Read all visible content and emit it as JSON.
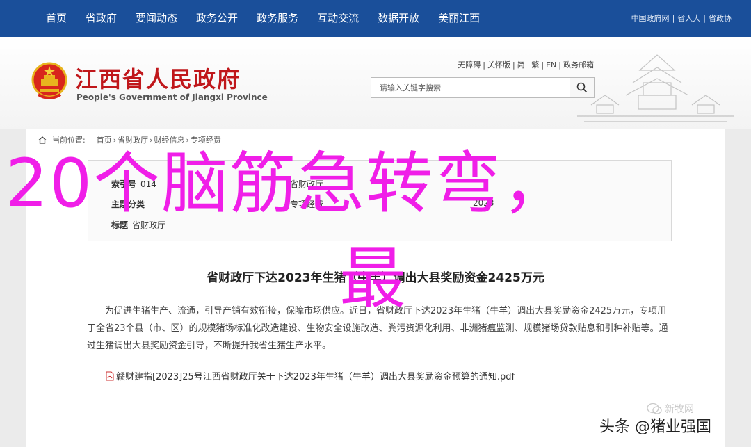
{
  "nav": {
    "items": [
      "首页",
      "省政府",
      "要闻动态",
      "政务公开",
      "政务服务",
      "互动交流",
      "数据开放",
      "美丽江西"
    ],
    "links": [
      "中国政府网",
      "省人大",
      "省政协"
    ]
  },
  "header": {
    "title": "江西省人民政府",
    "subtitle": "People's Government of Jiangxi Province",
    "access": [
      "无障碍",
      "关怀版",
      "简",
      "繁",
      "EN",
      "政务邮箱"
    ],
    "search_placeholder": "请输入关键字搜索"
  },
  "breadcrumb": {
    "label": "当前位置:",
    "items": [
      "首页",
      "省财政厅",
      "财经信息",
      "专项经费"
    ]
  },
  "meta": {
    "row1_key": "索引号",
    "row1_value": "014",
    "row1_col3": "省财政厅",
    "row2_key": "主题分类",
    "row2_col2": "专项经费",
    "row2_col3": "2023",
    "row3_key": "标题",
    "row3_value": "省财政厅"
  },
  "article": {
    "title": "省财政厅下达2023年生猪（牛羊）调出大县奖励资金2425万元",
    "body": "为促进生猪生产、流通，引导产销有效衔接，保障市场供应。近日，省财政厅下达2023年生猪（牛羊）调出大县奖励资金2425万元，专项用于全省23个县（市、区）的规模猪场标准化改造建设、生物安全设施改造、粪污资源化利用、非洲猪瘟监测、规模猪场贷款贴息和引种补贴等。通过生猪调出大县奖励资金引导，不断提升我省生猪生产水平。",
    "attachment": "赣财建指[2023]25号江西省财政厅关于下达2023年生猪（牛羊）调出大县奖励资金预算的通知.pdf"
  },
  "overlay": {
    "line1": "20个脑筋急转弯，",
    "line2": "最"
  },
  "watermark": {
    "small": "新牧网",
    "main": "头条 @猪业强国"
  },
  "colors": {
    "nav_bg": "#1a4f9a",
    "title_red": "#c0171b",
    "overlay_magenta": "#f01ee8"
  }
}
